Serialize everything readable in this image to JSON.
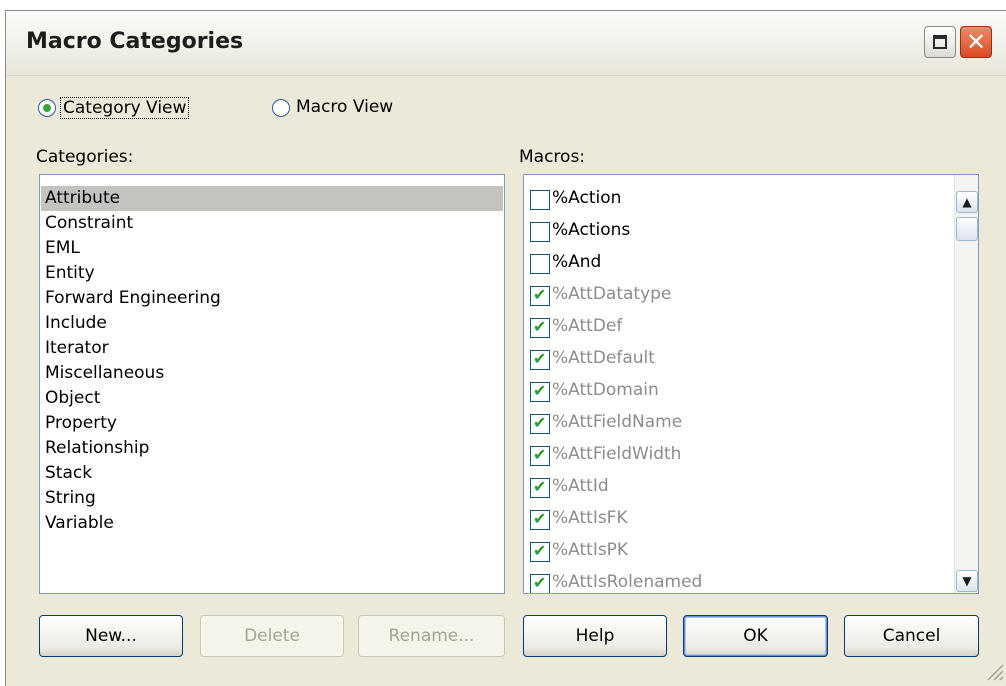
{
  "window": {
    "title": "Macro Categories"
  },
  "view_options": [
    {
      "label": "Category View",
      "selected": true
    },
    {
      "label": "Macro View",
      "selected": false
    }
  ],
  "categories": {
    "label": "Categories:",
    "items": [
      "Attribute",
      "Constraint",
      "EML",
      "Entity",
      "Forward Engineering",
      "Include",
      "Iterator",
      "Miscellaneous",
      "Object",
      "Property",
      "Relationship",
      "Stack",
      "String",
      "Variable"
    ],
    "selected": "Attribute"
  },
  "macros": {
    "label": "Macros:",
    "items": [
      {
        "label": "%Action",
        "checked": false
      },
      {
        "label": "%Actions",
        "checked": false
      },
      {
        "label": "%And",
        "checked": false
      },
      {
        "label": "%AttDatatype",
        "checked": true
      },
      {
        "label": "%AttDef",
        "checked": true
      },
      {
        "label": "%AttDefault",
        "checked": true
      },
      {
        "label": "%AttDomain",
        "checked": true
      },
      {
        "label": "%AttFieldName",
        "checked": true
      },
      {
        "label": "%AttFieldWidth",
        "checked": true
      },
      {
        "label": "%AttId",
        "checked": true
      },
      {
        "label": "%AttIsFK",
        "checked": true
      },
      {
        "label": "%AttIsPK",
        "checked": true
      },
      {
        "label": "%AttIsRolenamed",
        "checked": true
      }
    ]
  },
  "buttons": {
    "new": "New...",
    "delete": "Delete",
    "rename": "Rename...",
    "help": "Help",
    "ok": "OK",
    "cancel": "Cancel"
  },
  "colors": {
    "check_green": "#21a121",
    "disabled_text": "#8c8c8c",
    "selection": "#c3c3c0"
  }
}
